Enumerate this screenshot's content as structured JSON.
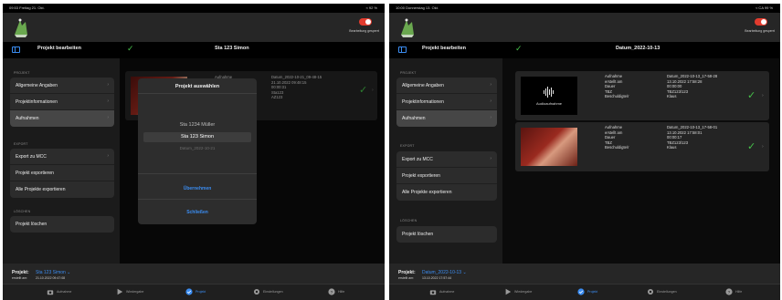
{
  "left": {
    "status": {
      "time": "09:53  Freitag 21. Okt.",
      "battery": "≈ 92 %"
    },
    "header": {
      "rec_label": "Bearbeitung gesperrt"
    },
    "nav": {
      "title": "Projekt bearbeiten",
      "detail_title": "Sta 123 Simon"
    },
    "sidebar": {
      "projekt_label": "PROJEKT",
      "projekt_items": [
        "Allgemeine Angaben",
        "Projektinformationen",
        "Aufnahmen"
      ],
      "export_label": "EXPORT",
      "export_items": [
        "Export zu MCC",
        "Projekt exportieren",
        "Alle Projekte exportieren"
      ],
      "loeschen_label": "LÖSCHEN",
      "loeschen_items": [
        "Projekt löschen"
      ]
    },
    "card": {
      "key_first": "Aufnahme",
      "values": [
        "Datum_2022-10-21_09-48-15",
        "21.10.2022 09:48:15",
        "00:00:31",
        "Sta123",
        "AZ123"
      ]
    },
    "modal": {
      "title": "Projekt auswählen",
      "options": [
        "Sta 1234 Müller",
        "Sta 123 Simon",
        "Datum_2022-10-21"
      ],
      "confirm": "Übernehmen",
      "close": "Schließen"
    },
    "bottom": {
      "project_label": "Projekt:",
      "project_value": "Sta 123 Simon  ⌄",
      "created_label": "erstellt am:",
      "created_value": "21.10.2022 09:47:08"
    },
    "tabs": [
      "Aufnahme",
      "Wiedergabe",
      "Projekt",
      "Einstellungen",
      "Hilfe"
    ]
  },
  "right": {
    "status": {
      "time": "10:00  Donnerstag 13. Okt.",
      "battery": "≈ CA 99 %"
    },
    "header": {
      "rec_label": "Bearbeitung gesperrt"
    },
    "nav": {
      "title": "Projekt bearbeiten",
      "detail_title": "Datum_2022-10-13"
    },
    "sidebar": {
      "projekt_label": "PROJEKT",
      "projekt_items": [
        "Allgemeine Angaben",
        "Projektinformationen",
        "Aufnahmen"
      ],
      "export_label": "EXPORT",
      "export_items": [
        "Export zu MCC",
        "Projekt exportieren",
        "Alle Projekte exportieren"
      ],
      "loeschen_label": "LÖSCHEN",
      "loeschen_items": [
        "Projekt löschen"
      ]
    },
    "cards": [
      {
        "thumb_caption": "Audioaufnahme",
        "keys": [
          "Aufnahme",
          "erstellt am",
          "Dauer",
          "TBZ",
          "Beschuldigte/r"
        ],
        "values": [
          "Datum_2022-10-13_17-58-28",
          "13.10.2022 17:58:28",
          "00:00:00",
          "TBZ123/123",
          "Klaus"
        ]
      },
      {
        "keys": [
          "Aufnahme",
          "erstellt am",
          "Dauer",
          "TBZ",
          "Beschuldigte/r"
        ],
        "values": [
          "Datum_2022-10-13_17-58-01",
          "13.10.2022 17:58:01",
          "00:00:17",
          "TBZ123/123",
          "Klaus"
        ]
      }
    ],
    "bottom": {
      "project_label": "Projekt:",
      "project_value": "Datum_2022-10-13  ⌄",
      "created_label": "erstellt am:",
      "created_value": "13.10.2022 17:57:44"
    },
    "tabs": [
      "Aufnahme",
      "Wiedergabe",
      "Projekt",
      "Einstellungen",
      "Hilfe"
    ]
  },
  "icons": {
    "check": "✓",
    "chevron": "›"
  },
  "colors": {
    "accent": "#3b8cf0",
    "success": "#46c24a",
    "record": "#e23b2e"
  }
}
